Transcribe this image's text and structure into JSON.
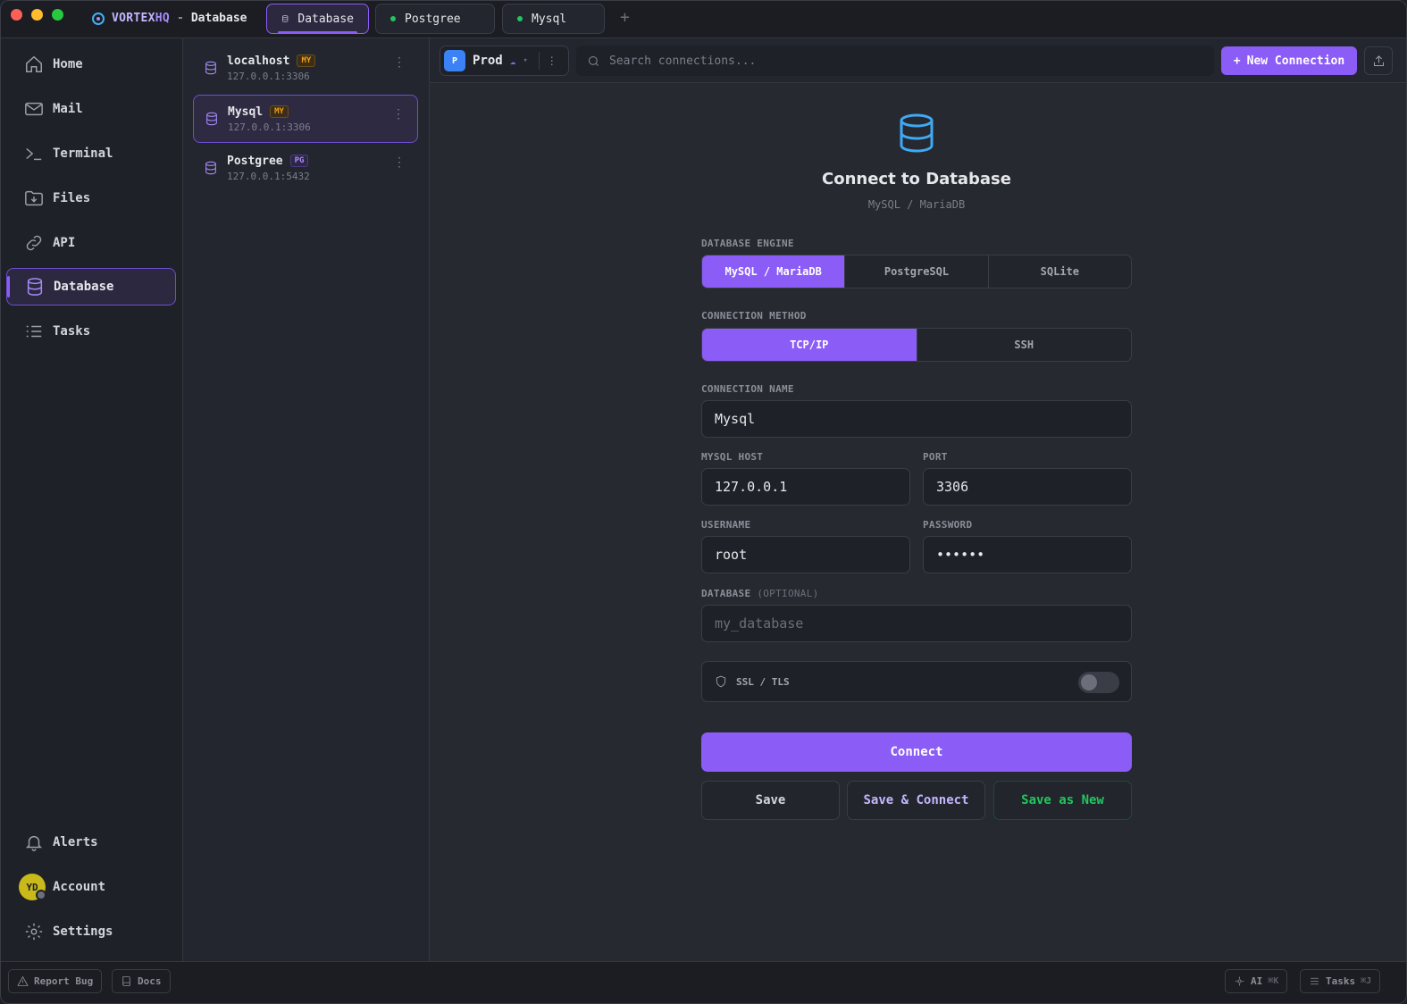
{
  "app": {
    "brand_a": "VORTEX",
    "brand_b": "HQ",
    "separator": "-",
    "window_name": "Database"
  },
  "tabs": [
    {
      "label": "Database"
    },
    {
      "label": "Postgree"
    },
    {
      "label": "Mysql"
    }
  ],
  "sidebar": {
    "items": [
      {
        "label": "Home"
      },
      {
        "label": "Mail"
      },
      {
        "label": "Terminal"
      },
      {
        "label": "Files"
      },
      {
        "label": "API"
      },
      {
        "label": "Database"
      },
      {
        "label": "Tasks"
      }
    ],
    "bottom": [
      {
        "label": "Alerts"
      },
      {
        "label": "Account"
      },
      {
        "label": "Settings"
      }
    ],
    "avatar_initials": "YD"
  },
  "connections": [
    {
      "name": "localhost",
      "badge": "MY",
      "addr": "127.0.0.1:3306"
    },
    {
      "name": "Mysql",
      "badge": "MY",
      "addr": "127.0.0.1:3306"
    },
    {
      "name": "Postgree",
      "badge": "PG",
      "addr": "127.0.0.1:5432"
    }
  ],
  "toolbar": {
    "env_badge": "P",
    "env_name": "Prod",
    "search_placeholder": "Search connections...",
    "new_connection": "New Connection"
  },
  "form": {
    "title": "Connect to Database",
    "subtitle": "MySQL / MariaDB",
    "engine_label": "DATABASE ENGINE",
    "engines": [
      "MySQL / MariaDB",
      "PostgreSQL",
      "SQLite"
    ],
    "method_label": "CONNECTION METHOD",
    "methods": [
      "TCP/IP",
      "SSH"
    ],
    "name_label": "CONNECTION NAME",
    "name_value": "Mysql",
    "host_label": "MYSQL HOST",
    "host_value": "127.0.0.1",
    "port_label": "PORT",
    "port_value": "3306",
    "username_label": "USERNAME",
    "username_value": "root",
    "password_label": "PASSWORD",
    "password_value": "••••••",
    "database_label": "DATABASE",
    "database_optional": "(OPTIONAL)",
    "database_placeholder": "my_database",
    "ssl_label": "SSL / TLS",
    "connect": "Connect",
    "save": "Save",
    "save_connect": "Save & Connect",
    "save_new": "Save as New"
  },
  "bottombar": {
    "report_bug": "Report Bug",
    "docs": "Docs",
    "ai": "AI",
    "ai_kbd": "⌘K",
    "tasks": "Tasks",
    "tasks_kbd": "⌘J"
  },
  "colors": {
    "accent": "#8b5cf6",
    "green": "#22c55e",
    "mysql_badge": "#f59e0b"
  }
}
